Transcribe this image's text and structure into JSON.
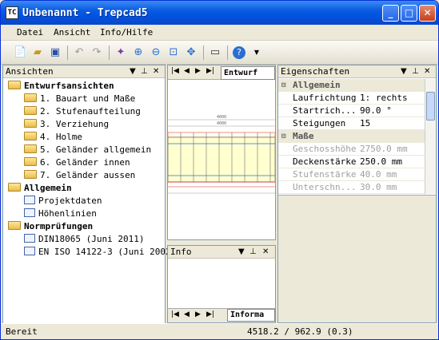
{
  "window": {
    "title": "Unbenannt - Trepcad5",
    "app_icon": "TC"
  },
  "menu": [
    "Datei",
    "Ansicht",
    "Info/Hilfe"
  ],
  "toolbar": {
    "icons": [
      "new-icon",
      "open-icon",
      "save-icon",
      "undo-icon",
      "redo-icon",
      "wizard-icon",
      "zoom-in-icon",
      "zoom-out-icon",
      "zoom-window-icon",
      "pan-icon",
      "measure-icon",
      "help-icon"
    ]
  },
  "ansichten": {
    "title": "Ansichten",
    "groups": [
      {
        "label": "Entwurfsansichten",
        "items": [
          "1. Bauart und Maße",
          "2. Stufenaufteilung",
          "3. Verziehung",
          "4. Holme",
          "5. Geländer allgemein",
          "6. Geländer innen",
          "7. Geländer aussen"
        ]
      },
      {
        "label": "Allgemein",
        "items": [
          "Projektdaten",
          "Höhenlinien"
        ]
      },
      {
        "label": "Normprüfungen",
        "items": [
          "DIN18065 (Juni 2011)",
          "EN ISO 14122-3 (Juni 2002)"
        ]
      }
    ]
  },
  "drawing": {
    "tab": "Entwurf",
    "dim1": "4000",
    "dim2": "4000"
  },
  "info": {
    "title": "Info",
    "tab": "Informa"
  },
  "eigenschaften": {
    "title": "Eigenschaften",
    "cat1": "Allgemein",
    "rows1": [
      {
        "name": "Laufrichtung",
        "value": "1: rechts"
      },
      {
        "name": "Startrich...",
        "value": "90.0 °"
      },
      {
        "name": "Steigungen",
        "value": "15"
      }
    ],
    "cat2": "Maße",
    "rows2": [
      {
        "name": "Geschosshöhe",
        "value": "2750.0 mm"
      },
      {
        "name": "Deckenstärke",
        "value": "250.0 mm"
      },
      {
        "name": "Stufenstärke",
        "value": "40.0 mm"
      },
      {
        "name": "Unterschn...",
        "value": "30.0 mm"
      }
    ]
  },
  "status": {
    "text": "Bereit",
    "coords": "4518.2 / 962.9 (0.3)"
  }
}
